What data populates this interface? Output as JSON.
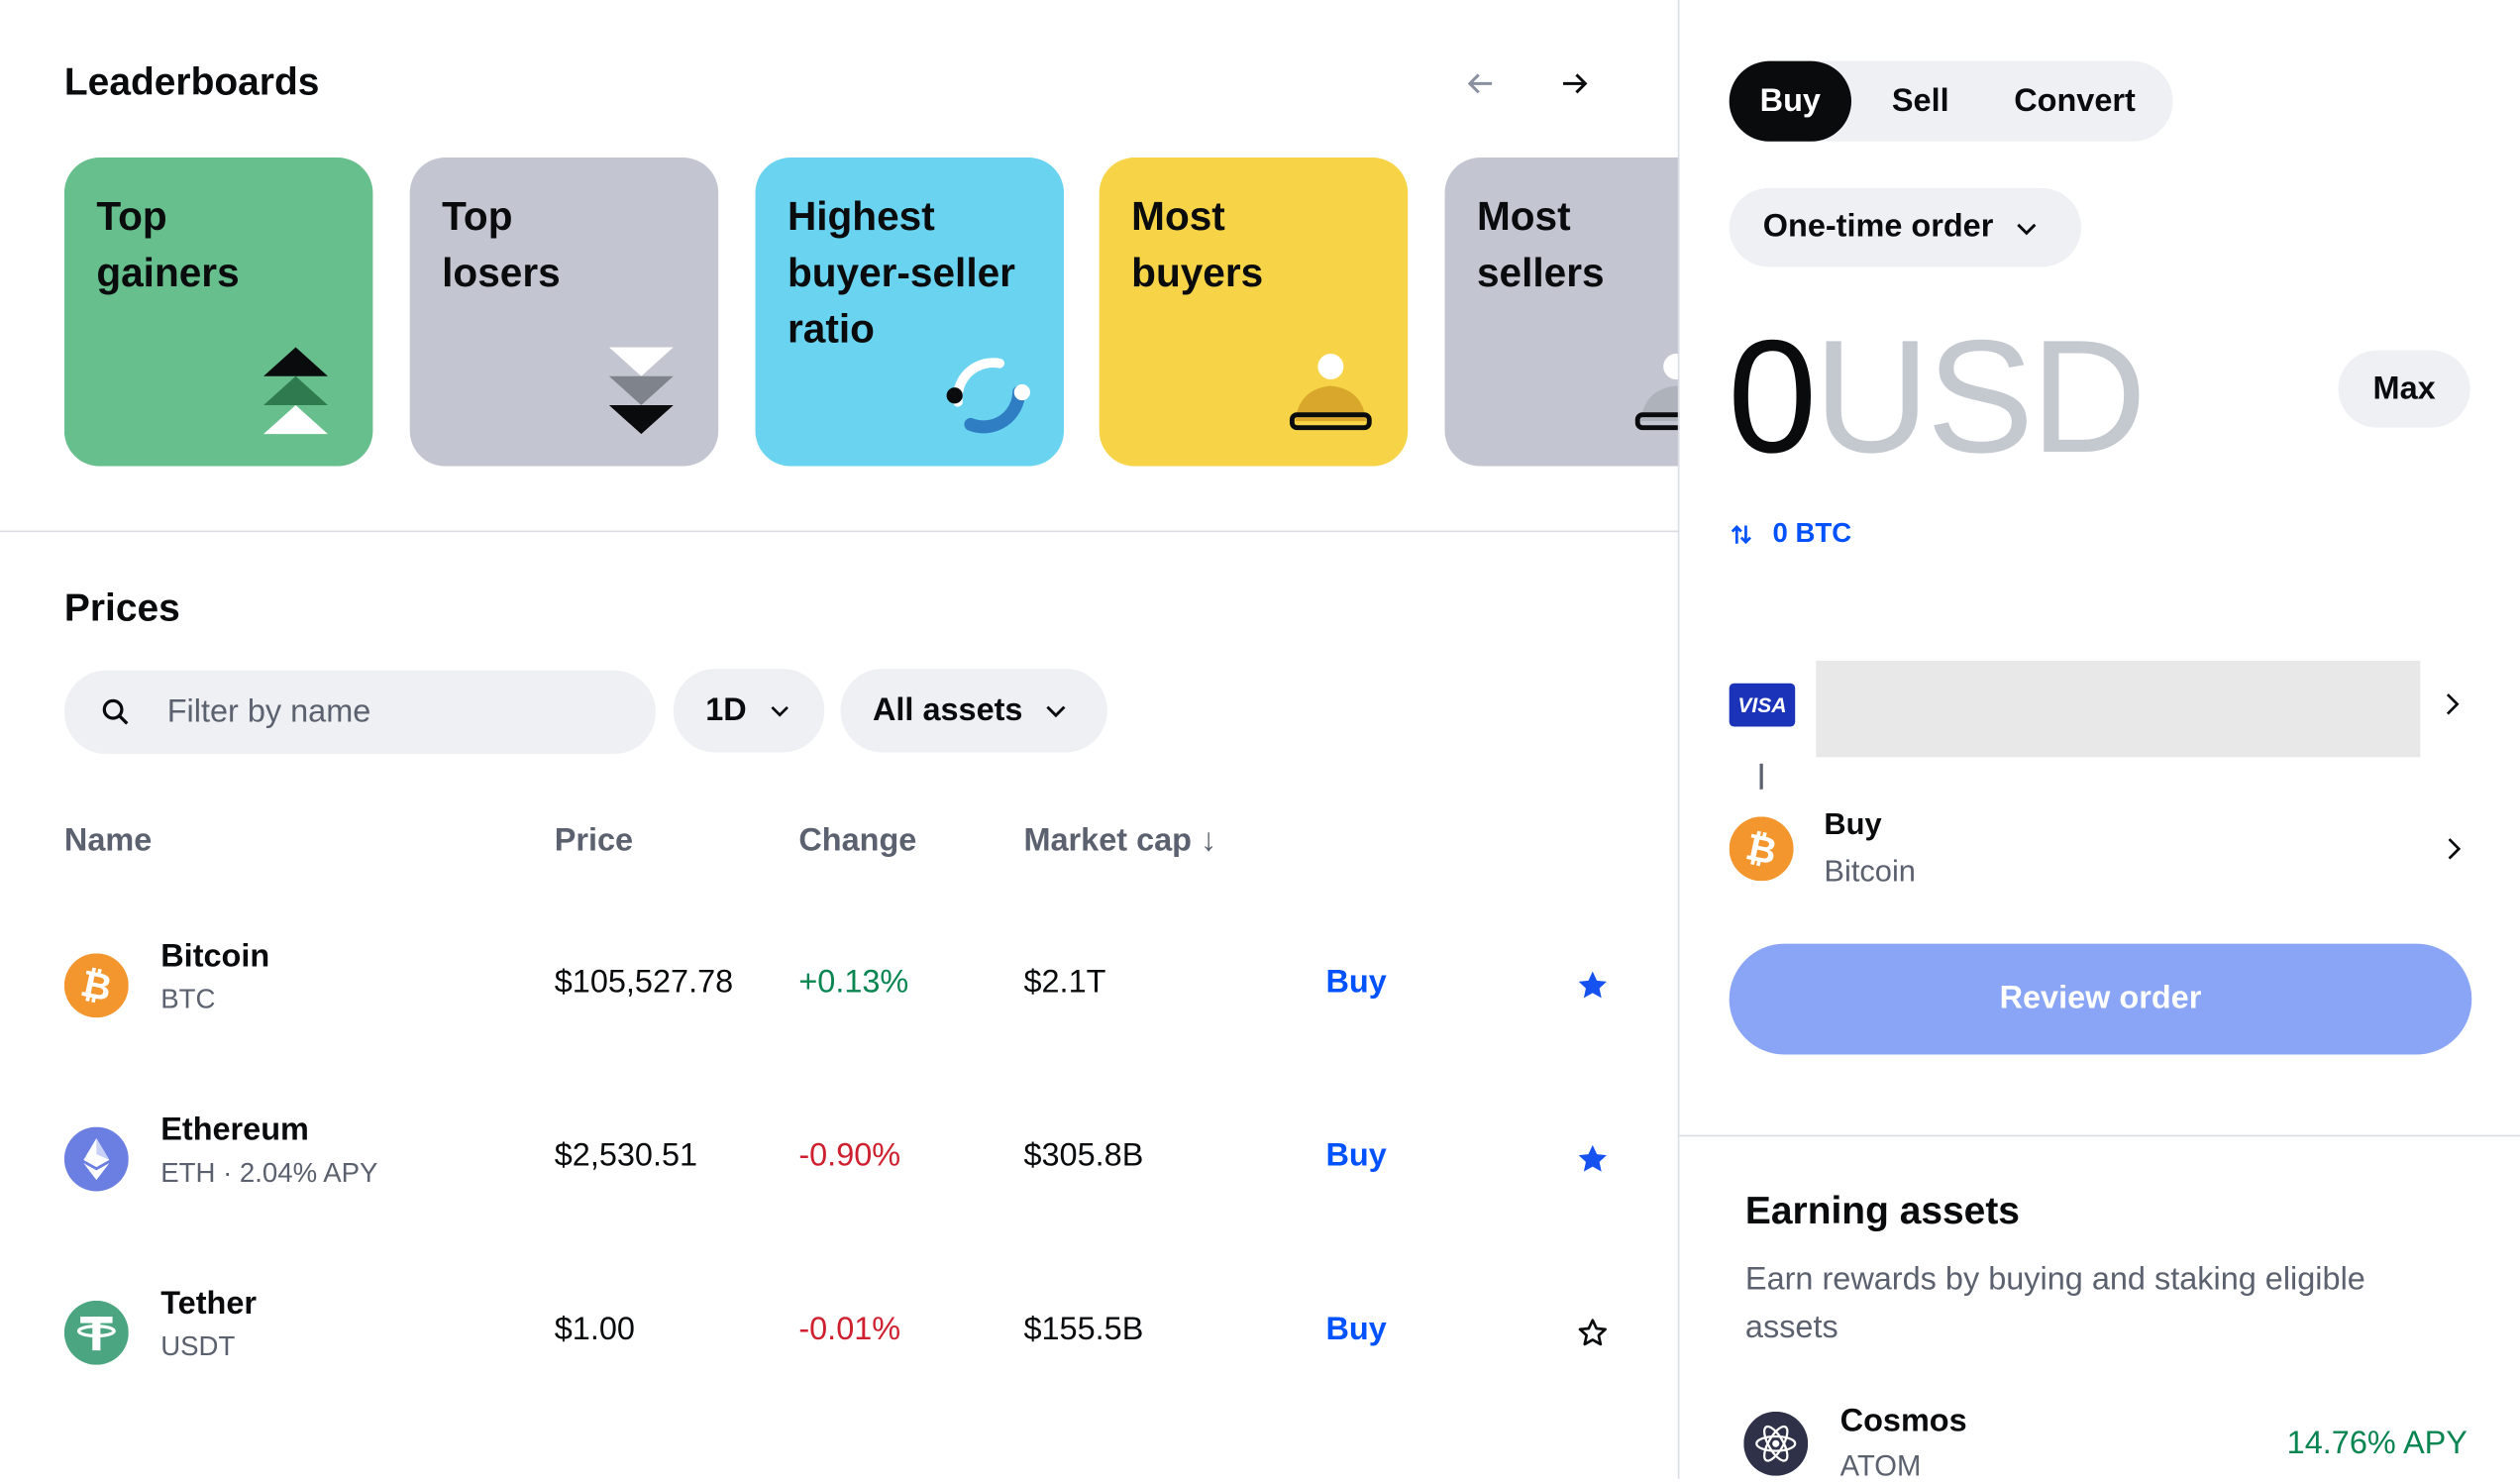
{
  "leaderboards": {
    "title": "Leaderboards",
    "cards": [
      {
        "label": "Top\ngainers",
        "bg": "#66bf8c",
        "icon": "arrow-up-stack-icon"
      },
      {
        "label": "Top\nlosers",
        "bg": "#c3c6d0",
        "icon": "arrow-down-stack-icon"
      },
      {
        "label": "Highest\nbuyer-seller\nratio",
        "bg": "#6ad3f0",
        "icon": "ratio-arc-icon"
      },
      {
        "label": "Most\nbuyers",
        "bg": "#f7d447",
        "icon": "buyer-person-icon"
      },
      {
        "label": "Most\nsellers",
        "bg": "#c3c6d0",
        "icon": "seller-person-icon"
      }
    ]
  },
  "prices": {
    "title": "Prices",
    "search_placeholder": "Filter by name",
    "period": "1D",
    "asset_filter": "All assets",
    "columns": {
      "name": "Name",
      "price": "Price",
      "change": "Change",
      "market_cap": "Market cap ↓"
    },
    "rows": [
      {
        "name": "Bitcoin",
        "symbol": "BTC",
        "price": "$105,527.78",
        "change": "+0.13%",
        "direction": "up",
        "market_cap": "$2.1T",
        "action": "Buy",
        "starred": true,
        "icon": "bitcoin-icon",
        "color": "#f2962d"
      },
      {
        "name": "Ethereum",
        "symbol": "ETH · 2.04% APY",
        "price": "$2,530.51",
        "change": "-0.90%",
        "direction": "down",
        "market_cap": "$305.8B",
        "action": "Buy",
        "starred": true,
        "icon": "ethereum-icon",
        "color": "#6b7fe3"
      },
      {
        "name": "Tether",
        "symbol": "USDT",
        "price": "$1.00",
        "change": "-0.01%",
        "direction": "down",
        "market_cap": "$155.5B",
        "action": "Buy",
        "starred": false,
        "icon": "tether-icon",
        "color": "#4ba581"
      }
    ]
  },
  "trade": {
    "tabs": [
      "Buy",
      "Sell",
      "Convert"
    ],
    "active_tab": "Buy",
    "order_type": "One-time order",
    "amount": "0",
    "currency": "USD",
    "max_label": "Max",
    "converted": "0 BTC",
    "payment_brand": "VISA",
    "asset_action": "Buy",
    "asset_name": "Bitcoin",
    "review_label": "Review order"
  },
  "earning": {
    "title": "Earning assets",
    "description": "Earn rewards by buying and staking eligible assets",
    "items": [
      {
        "name": "Cosmos",
        "symbol": "ATOM",
        "apy": "14.76% APY",
        "icon": "cosmos-icon"
      }
    ]
  },
  "colors": {
    "accent": "#0052ff",
    "positive": "#098551",
    "negative": "#cf202f"
  }
}
